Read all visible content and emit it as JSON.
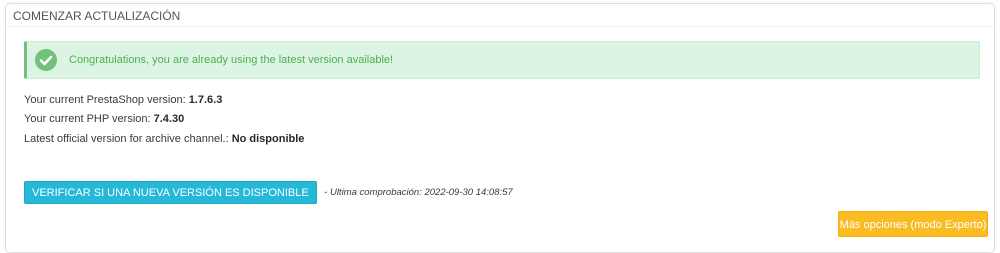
{
  "panel": {
    "title": "COMENZAR ACTUALIZACIÓN"
  },
  "alert": {
    "icon": "check-circle-icon",
    "message": "Congratulations, you are already using the latest version available!"
  },
  "info": {
    "prestashop_label": "Your current PrestaShop version: ",
    "prestashop_value": "1.7.6.3",
    "php_label": "Your current PHP version: ",
    "php_value": "7.4.30",
    "channel_label": "Latest official version for archive channel.: ",
    "channel_value": "No disponible"
  },
  "check": {
    "button_label": "VERIFICAR SI UNA NUEVA VERSIÓN ES DISPONIBLE",
    "last_check": "- Ultima comprobación: 2022-09-30 14:08:57"
  },
  "expert_button_label": "Más opciones (modo Experto)",
  "colors": {
    "primary": "#25b9d7",
    "warning": "#fbbb22",
    "success": "#72c279",
    "success_bg": "#dcf4e3"
  }
}
